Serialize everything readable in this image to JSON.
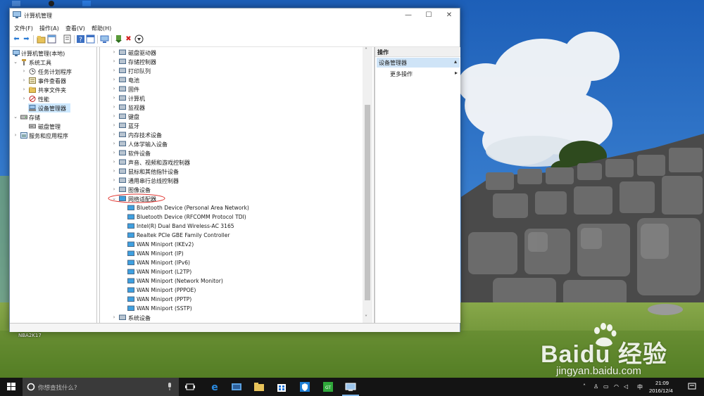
{
  "window": {
    "title": "计算机管理",
    "controls": {
      "minimize": "—",
      "maximize": "☐",
      "close": "✕"
    }
  },
  "menu": [
    "文件(F)",
    "操作(A)",
    "查看(V)",
    "帮助(H)"
  ],
  "left_tree": [
    {
      "label": "计算机管理(本地)",
      "icon": "computer-management-icon"
    },
    {
      "label": "系统工具",
      "icon": "tools-icon"
    },
    {
      "label": "任务计划程序",
      "icon": "clock-icon"
    },
    {
      "label": "事件查看器",
      "icon": "event-viewer-icon"
    },
    {
      "label": "共享文件夹",
      "icon": "shared-folder-icon"
    },
    {
      "label": "性能",
      "icon": "performance-icon"
    },
    {
      "label": "设备管理器",
      "icon": "device-manager-icon",
      "selected": true
    },
    {
      "label": "存储",
      "icon": "storage-icon"
    },
    {
      "label": "磁盘管理",
      "icon": "disk-icon"
    },
    {
      "label": "服务和应用程序",
      "icon": "services-icon"
    }
  ],
  "device_categories": [
    {
      "label": "磁盘驱动器",
      "icon": "disk-drive-icon"
    },
    {
      "label": "存储控制器",
      "icon": "storage-controller-icon"
    },
    {
      "label": "打印队列",
      "icon": "printer-icon"
    },
    {
      "label": "电池",
      "icon": "battery-icon"
    },
    {
      "label": "固件",
      "icon": "firmware-icon"
    },
    {
      "label": "计算机",
      "icon": "computer-icon"
    },
    {
      "label": "监视器",
      "icon": "monitor-icon"
    },
    {
      "label": "键盘",
      "icon": "keyboard-icon"
    },
    {
      "label": "蓝牙",
      "icon": "bluetooth-icon"
    },
    {
      "label": "内存技术设备",
      "icon": "memory-icon"
    },
    {
      "label": "人体学输入设备",
      "icon": "hid-icon"
    },
    {
      "label": "软件设备",
      "icon": "software-device-icon"
    },
    {
      "label": "声音、视频和游戏控制器",
      "icon": "sound-icon"
    },
    {
      "label": "鼠标和其他指针设备",
      "icon": "mouse-icon"
    },
    {
      "label": "通用串行总线控制器",
      "icon": "usb-icon"
    },
    {
      "label": "图像设备",
      "icon": "camera-icon"
    }
  ],
  "network_adapters": {
    "label": "网络适配器",
    "icon": "network-adapter-icon",
    "children": [
      "Bluetooth Device (Personal Area Network)",
      "Bluetooth Device (RFCOMM Protocol TDI)",
      "Intel(R) Dual Band Wireless-AC 3165",
      "Realtek PCIe GBE Family Controller",
      "WAN Miniport (IKEv2)",
      "WAN Miniport (IP)",
      "WAN Miniport (IPv6)",
      "WAN Miniport (L2TP)",
      "WAN Miniport (Network Monitor)",
      "WAN Miniport (PPPOE)",
      "WAN Miniport (PPTP)",
      "WAN Miniport (SSTP)"
    ]
  },
  "after_categories": [
    {
      "label": "系统设备",
      "icon": "system-device-icon"
    }
  ],
  "actions": {
    "header": "操作",
    "section": "设备管理器",
    "more": "更多操作"
  },
  "taskbar": {
    "search_placeholder": "你想查找什么?",
    "time": "21:09",
    "date": "2016/12/4",
    "ime": "中",
    "apps": [
      "task-view-icon",
      "edge-icon",
      "store-icon-2",
      "file-explorer-icon",
      "store-icon",
      "shield-app-icon",
      "green-app-icon",
      "computer-management-task-icon"
    ]
  },
  "desktop": {
    "bottom_left_text": "NBA2K17",
    "watermark_logo": "Baidu 经验",
    "watermark_url": "jingyan.baidu.com"
  },
  "colors": {
    "selection": "#cde8ff",
    "network_circle": "#e0342f",
    "sky": "#2a6fc4",
    "grass": "#6e9a36"
  }
}
